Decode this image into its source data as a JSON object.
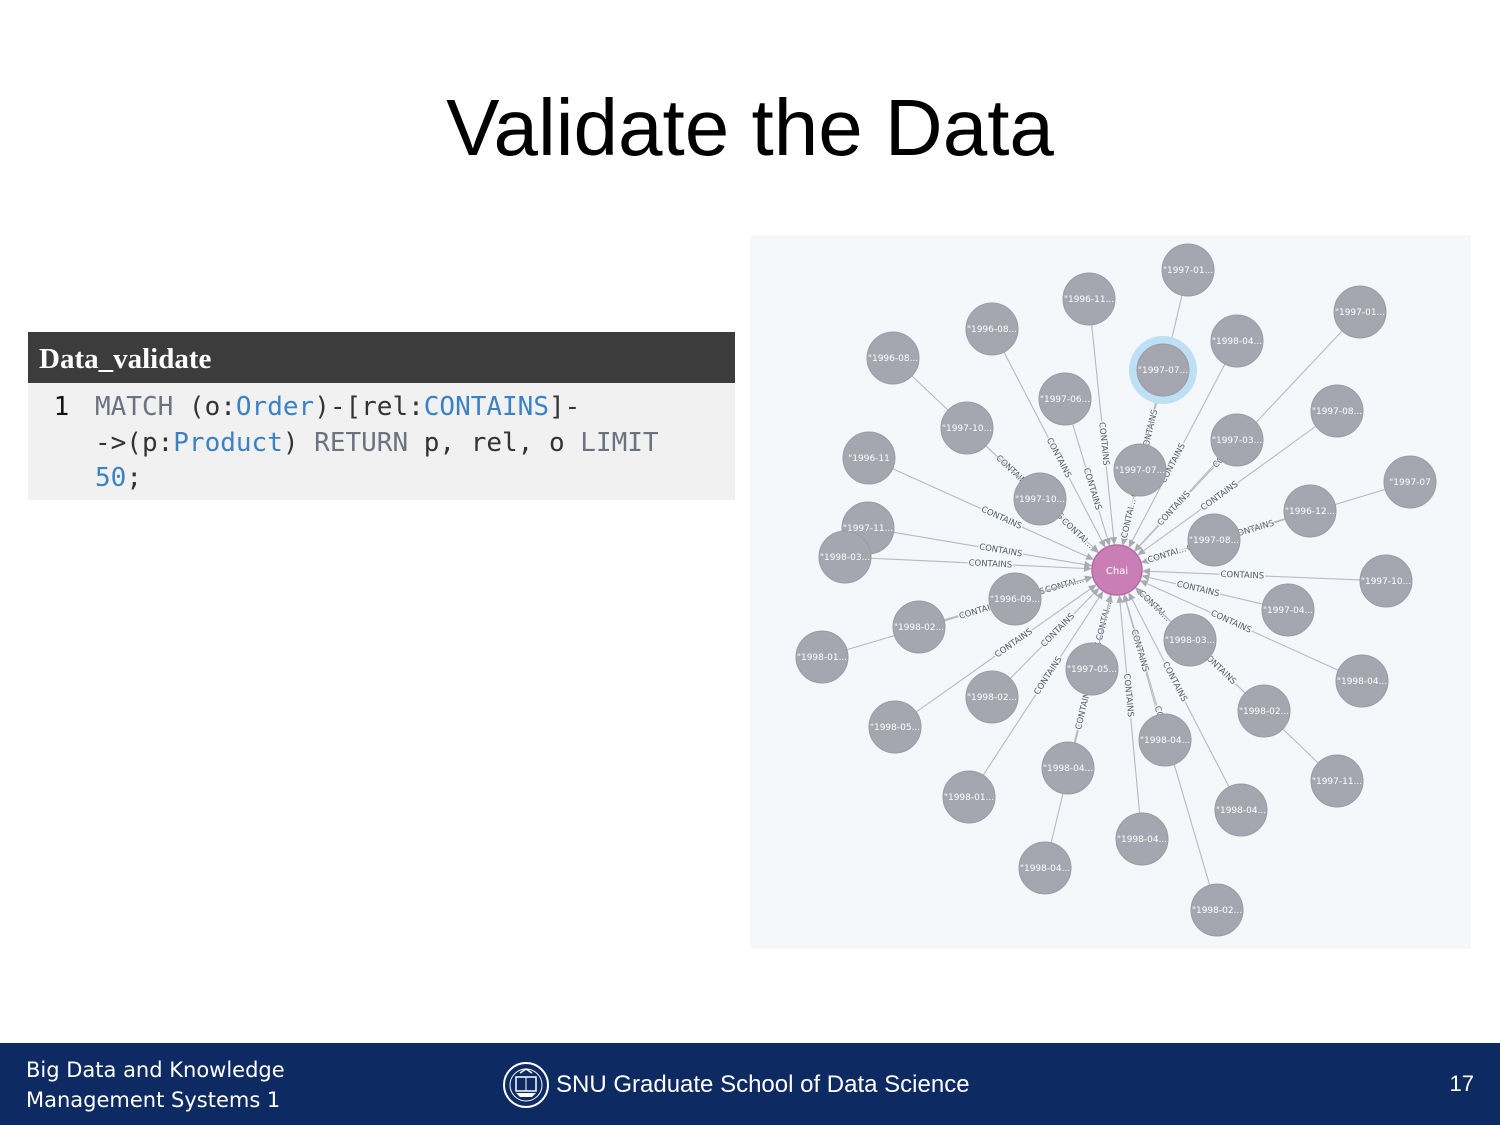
{
  "slide": {
    "title": "Validate the Data"
  },
  "code_panel": {
    "header": "Data_validate",
    "line_number": "1",
    "tokens": {
      "match": "MATCH",
      "open_o": " (o:",
      "order": "Order",
      "mid1": ")-[rel:",
      "contains": "CONTAINS",
      "end1": "]-",
      "arrow": "->(p:",
      "product": "Product",
      "mid2": ") ",
      "return": "RETURN",
      "mid3": " p, rel, o ",
      "limit": "LIMIT",
      "num": "50",
      "semi": ";"
    }
  },
  "graph": {
    "center": {
      "label": "Chai",
      "color": "#c97fb5"
    },
    "node_color": "#a5a6b0",
    "selected_ring_color": "#bfdff5",
    "edge_label": "CONTAINS",
    "edge_label_short": "CONTAI...",
    "nodes": [
      {
        "label": "\"1997-01...",
        "selected": false
      },
      {
        "label": "\"1996-11...",
        "selected": false
      },
      {
        "label": "\"1996-08...",
        "selected": false
      },
      {
        "label": "\"1996-08...",
        "selected": false
      },
      {
        "label": "\"1998-04...",
        "selected": false
      },
      {
        "label": "\"1997-01...",
        "selected": false
      },
      {
        "label": "\"1997-07...",
        "selected": true
      },
      {
        "label": "\"1997-06...",
        "selected": false
      },
      {
        "label": "\"1997-10...",
        "selected": false
      },
      {
        "label": "\"1997-08...",
        "selected": false
      },
      {
        "label": "\"1997-03...",
        "selected": false
      },
      {
        "label": "\"1996-11",
        "selected": false
      },
      {
        "label": "\"1997-07...",
        "selected": false
      },
      {
        "label": "\"1997-10...",
        "selected": false
      },
      {
        "label": "\"1997-07",
        "selected": false
      },
      {
        "label": "\"1997-11...",
        "selected": false
      },
      {
        "label": "\"1996-12...",
        "selected": false
      },
      {
        "label": "\"1997-08...",
        "selected": false
      },
      {
        "label": "\"1998-03...",
        "selected": false
      },
      {
        "label": "\"1997-10...",
        "selected": false
      },
      {
        "label": "\"1996-09...",
        "selected": false
      },
      {
        "label": "\"1997-04...",
        "selected": false
      },
      {
        "label": "\"1998-02...",
        "selected": false
      },
      {
        "label": "\"1998-03...",
        "selected": false
      },
      {
        "label": "\"1998-01...",
        "selected": false
      },
      {
        "label": "\"1997-05...",
        "selected": false
      },
      {
        "label": "\"1998-04...",
        "selected": false
      },
      {
        "label": "\"1998-02...",
        "selected": false
      },
      {
        "label": "\"1998-02...",
        "selected": false
      },
      {
        "label": "\"1998-05...",
        "selected": false
      },
      {
        "label": "\"1998-04...",
        "selected": false
      },
      {
        "label": "\"1997-11...",
        "selected": false
      },
      {
        "label": "\"1998-04...",
        "selected": false
      },
      {
        "label": "\"1998-01...",
        "selected": false
      },
      {
        "label": "\"1998-04...",
        "selected": false
      },
      {
        "label": "\"1998-04...",
        "selected": false
      },
      {
        "label": "\"1998-04...",
        "selected": false
      },
      {
        "label": "\"1998-02...",
        "selected": false
      }
    ]
  },
  "footer": {
    "course_line1": "Big Data and Knowledge",
    "course_line2": "Management Systems 1",
    "school": "SNU Graduate School of Data Science",
    "page": "17"
  }
}
